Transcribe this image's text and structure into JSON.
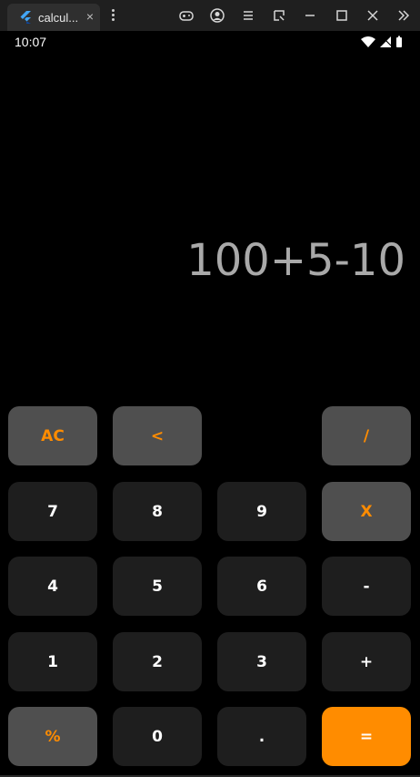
{
  "window": {
    "tab_title": "calcul...",
    "tab_close": "×"
  },
  "status_bar": {
    "time": "10:07"
  },
  "display": {
    "expression": "100+5-10"
  },
  "keys": {
    "ac": "AC",
    "back": "<",
    "divide": "/",
    "seven": "7",
    "eight": "8",
    "nine": "9",
    "multiply": "X",
    "four": "4",
    "five": "5",
    "six": "6",
    "minus": "-",
    "one": "1",
    "two": "2",
    "three": "3",
    "plus": "+",
    "percent": "%",
    "zero": "0",
    "dot": ".",
    "equals": "="
  },
  "colors": {
    "accent": "#ff8c00",
    "operator_key": "#4f4f4f",
    "number_key": "#1e1e1e",
    "display_text": "#a9a9a9"
  }
}
